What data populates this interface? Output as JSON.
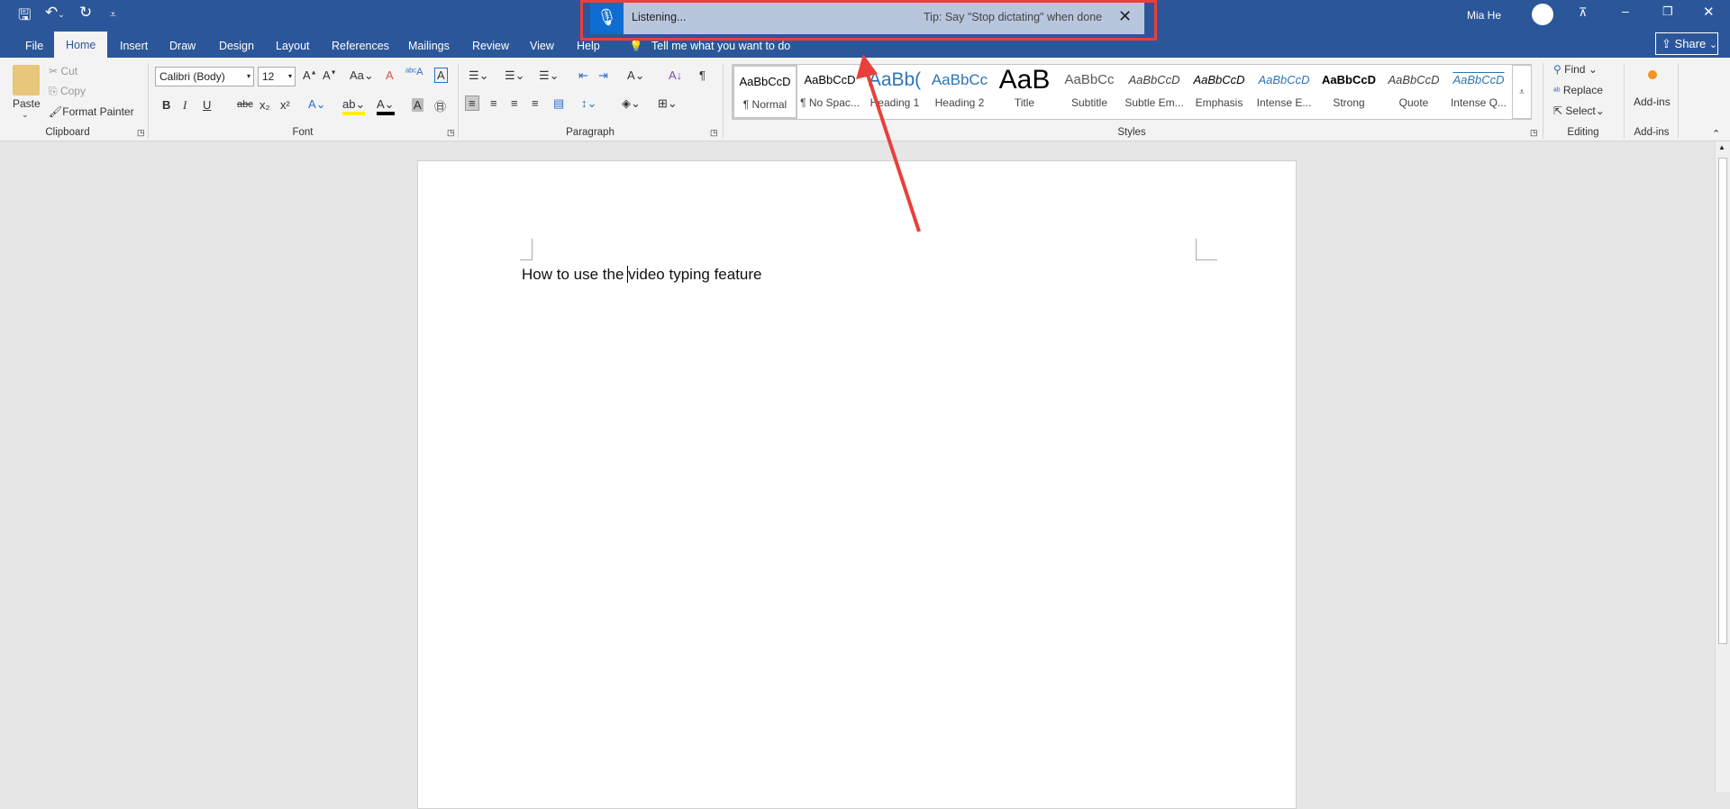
{
  "quick_access": {
    "save": "save-icon",
    "undo": "undo-icon",
    "redo": "redo-icon",
    "customize": "customize-icon"
  },
  "tabs": [
    "File",
    "Home",
    "Insert",
    "Draw",
    "Design",
    "Layout",
    "References",
    "Mailings",
    "Review",
    "View",
    "Help"
  ],
  "tell_me": "Tell me what you want to do",
  "user": {
    "name": "Mia He"
  },
  "share_label": "Share",
  "dictation": {
    "status": "Listening...",
    "tip": "Tip: Say \"Stop dictating\" when done"
  },
  "clipboard": {
    "paste": "Paste",
    "cut": "Cut",
    "copy": "Copy",
    "format_painter": "Format Painter",
    "label": "Clipboard"
  },
  "font": {
    "name": "Calibri (Body)",
    "size": "12",
    "label": "Font",
    "bold": "B",
    "italic": "I",
    "underline": "U",
    "strike": "abc",
    "case": "Aa"
  },
  "paragraph": {
    "label": "Paragraph"
  },
  "styles": {
    "label": "Styles",
    "items": [
      {
        "preview": "AaBbCcD",
        "name": "¶ Normal"
      },
      {
        "preview": "AaBbCcD",
        "name": "¶ No Spac..."
      },
      {
        "preview": "AaBb(",
        "name": "Heading 1"
      },
      {
        "preview": "AaBbCc",
        "name": "Heading 2"
      },
      {
        "preview": "AaB",
        "name": "Title"
      },
      {
        "preview": "AaBbCc",
        "name": "Subtitle"
      },
      {
        "preview": "AaBbCcD",
        "name": "Subtle Em..."
      },
      {
        "preview": "AaBbCcD",
        "name": "Emphasis"
      },
      {
        "preview": "AaBbCcD",
        "name": "Intense E..."
      },
      {
        "preview": "AaBbCcD",
        "name": "Strong"
      },
      {
        "preview": "AaBbCcD",
        "name": "Quote"
      },
      {
        "preview": "AaBbCcD",
        "name": "Intense Q..."
      }
    ]
  },
  "editing": {
    "find": "Find",
    "replace": "Replace",
    "select": "Select",
    "label": "Editing"
  },
  "addins": {
    "button": "Add-ins",
    "label": "Add-ins"
  },
  "document": {
    "text_before": "How to use the ",
    "text_after": "video typing feature"
  },
  "colors": {
    "brand": "#2b579a",
    "highlight_box": "#e8403a"
  }
}
